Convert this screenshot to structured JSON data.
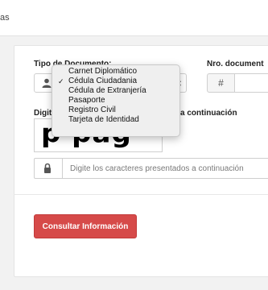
{
  "header": {
    "partial_text": "as"
  },
  "form": {
    "tipo_label": "Tipo de Documento:",
    "nro_label": "Nro. document",
    "captcha_label_left": "Digit",
    "captcha_label_right": "a continuación",
    "captcha_image_text": "p pag",
    "code_placeholder": "Digite los caracteres presentados a continuación",
    "num_symbol": "#",
    "consult_button": "Consultar Información"
  },
  "dropdown": {
    "selected_index": 1,
    "check_glyph": "✓",
    "options": [
      "Carnet Diplomático",
      "Cédula Ciudadania",
      "Cédula de Extranjería",
      "Pasaporte",
      "Registro Civil",
      "Tarjeta de Identidad"
    ]
  },
  "colors": {
    "accent": "#d64a49",
    "background": "#f2f2f2"
  }
}
